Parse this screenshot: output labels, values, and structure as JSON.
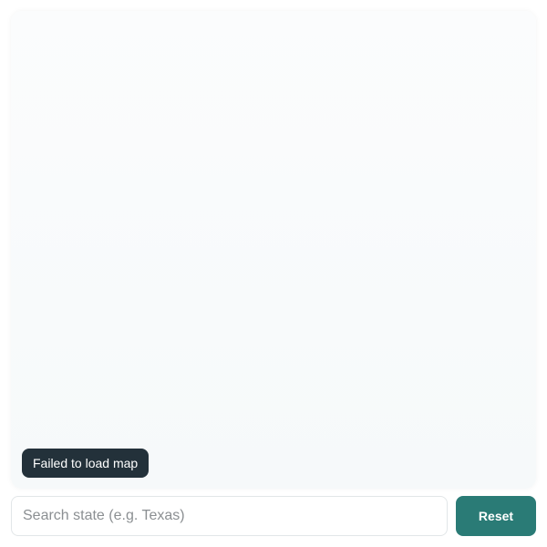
{
  "map": {
    "error_message": "Failed to load map"
  },
  "search": {
    "value": "",
    "placeholder": "Search state (e.g. Texas)"
  },
  "actions": {
    "reset_label": "Reset"
  },
  "colors": {
    "accent": "#2a7b76",
    "toast_background": "#23313a"
  }
}
